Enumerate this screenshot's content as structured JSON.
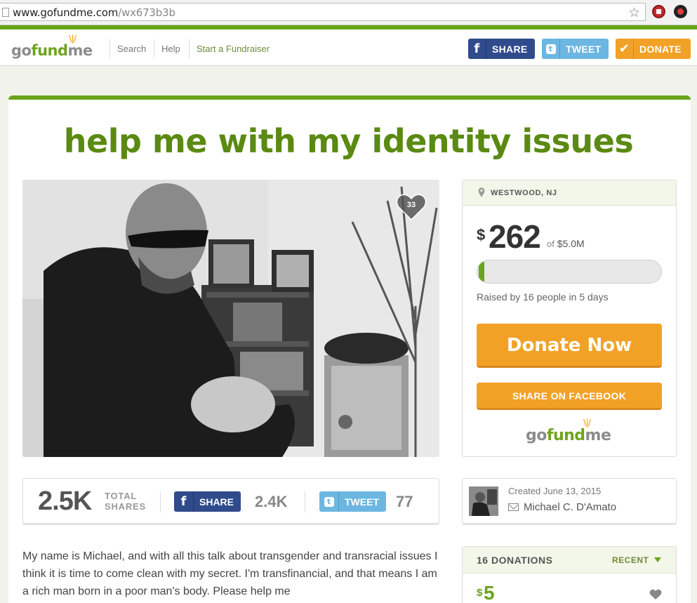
{
  "browser": {
    "url_host": "www.gofundme.com",
    "url_path": "/wx673b3b"
  },
  "header": {
    "logo": {
      "go": "go",
      "fund": "fund",
      "me": "me"
    },
    "nav": [
      "Search",
      "Help",
      "Start a Fundraiser"
    ],
    "share_label": "SHARE",
    "tweet_label": "TWEET",
    "donate_label": "DONATE"
  },
  "campaign": {
    "title": "help me with my identity issues",
    "heart_count": "33",
    "location": "WESTWOOD, NJ",
    "raised_currency": "$",
    "raised_amount": "262",
    "goal_of": "of",
    "goal": "$5.0M",
    "progress_fraction": 5e-05,
    "raised_by": "Raised by 16 people in 5 days",
    "donate_now_label": "Donate Now",
    "share_facebook_label": "SHARE ON FACEBOOK"
  },
  "shares": {
    "total": "2.5K",
    "total_label_1": "TOTAL",
    "total_label_2": "SHARES",
    "share_label": "SHARE",
    "facebook_count": "2.4K",
    "tweet_label": "TWEET",
    "twitter_count": "77"
  },
  "organizer": {
    "created": "Created June 13, 2015",
    "name": "Michael C. D'Amato"
  },
  "story": {
    "text": "My name is Michael, and with all this talk about transgender and transracial issues I think it is time to come clean with my secret. I'm transfinancial, and that means I am a rich man born in a poor man's body. Please help me"
  },
  "donations": {
    "count_label": "16 DONATIONS",
    "sort_label": "RECENT",
    "first_currency": "$",
    "first_amount": "5"
  },
  "colors": {
    "brand_green": "#6aa41c",
    "title_green": "#5a8a12",
    "donate_orange": "#f2a127",
    "facebook_blue": "#2f4b8b",
    "twitter_blue": "#6cb6e2"
  },
  "icons": [
    "page-icon",
    "star-icon",
    "adblock-icon",
    "extension-icon",
    "facebook-icon",
    "twitter-icon",
    "check-icon",
    "heart-icon",
    "map-pin-icon",
    "mail-icon",
    "chevron-down-icon"
  ]
}
